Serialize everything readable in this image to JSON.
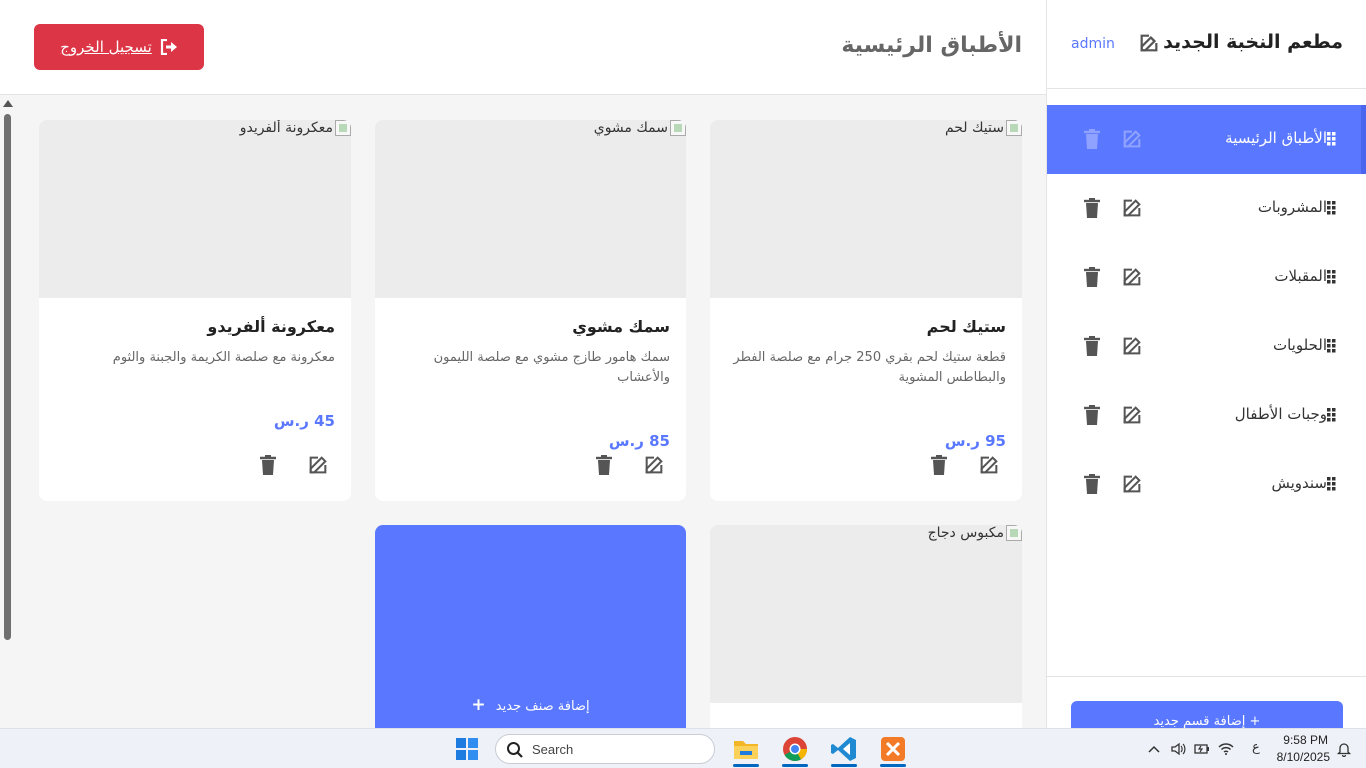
{
  "sidebar": {
    "restaurant_name": "مطعم النخبة الجديد",
    "admin_label": "admin",
    "categories": [
      {
        "label": "الأطباق الرئيسية",
        "active": true
      },
      {
        "label": "المشروبات",
        "active": false
      },
      {
        "label": "المقبلات",
        "active": false
      },
      {
        "label": "الحلويات",
        "active": false
      },
      {
        "label": "وجبات الأطفال",
        "active": false
      },
      {
        "label": "سندويش",
        "active": false
      }
    ],
    "add_category_label": "+ إضافة قسم جديد"
  },
  "header": {
    "title": "الأطباق الرئيسية",
    "logout_label": "تسجيل الخروج"
  },
  "items": [
    {
      "alt": "ستيك لحم",
      "title": "ستيك لحم",
      "description": "قطعة ستيك لحم بقري 250 جرام مع صلصة الفطر والبطاطس المشوية",
      "price": "95 ر.س"
    },
    {
      "alt": "سمك مشوي",
      "title": "سمك مشوي",
      "description": "سمك هامور طازج مشوي مع صلصة الليمون والأعشاب",
      "price": "85 ر.س"
    },
    {
      "alt": "معكرونة ألفريدو",
      "title": "معكرونة ألفريدو",
      "description": "معكرونة مع صلصة الكريمة والجبنة والثوم",
      "price": "45 ر.س"
    },
    {
      "alt": "مكبوس دجاج",
      "title": "",
      "description": "",
      "price": ""
    }
  ],
  "add_item_label": "إضافة صنف جديد",
  "taskbar": {
    "search_placeholder": "Search",
    "time": "9:58 PM",
    "date": "8/10/2025",
    "lang": "ع"
  },
  "colors": {
    "accent": "#5a78ff",
    "danger": "#dc3545"
  }
}
